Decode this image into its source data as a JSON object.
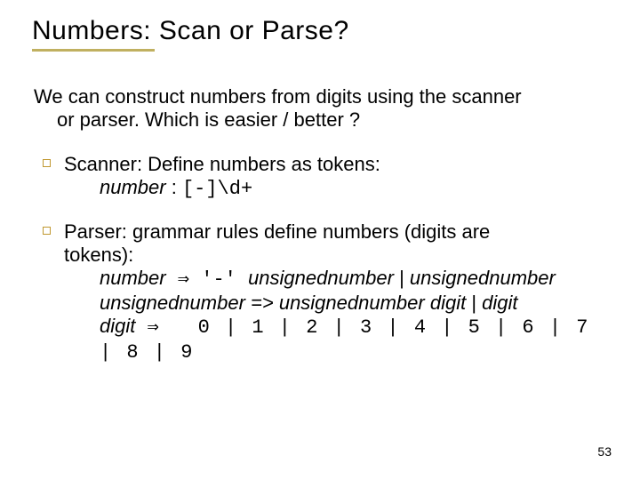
{
  "title": "Numbers:  Scan or Parse?",
  "intro": {
    "line1": "We can construct numbers from digits using the scanner",
    "line2": "or parser.  Which is easier / better ?"
  },
  "scanner": {
    "lead": "Scanner:  Define numbers as tokens:",
    "lhs": "number",
    "colon": " : ",
    "rhs": "[-]\\d+"
  },
  "parser": {
    "lead1": "Parser: grammar rules define numbers (digits are",
    "lead2": "tokens):",
    "rule1": {
      "lhs": "number",
      "arrow": " ⇒ ",
      "rhs_a": "'-' ",
      "rhs_b": "unsignednumber",
      "pipe": " | ",
      "rhs_c": "unsignednumber"
    },
    "rule2": {
      "lhs": "unsignednumber",
      "arrow": " => ",
      "rhs_a": "unsignednumber digit",
      "pipe": "  |  ",
      "rhs_b": "digit"
    },
    "rule3": {
      "lhs": "digit",
      "arrow": " ⇒ ",
      "rhs": "0 | 1 | 2 | 3 | 4 | 5 | 6 | 7 | 8 | 9"
    }
  },
  "page_number": "53"
}
